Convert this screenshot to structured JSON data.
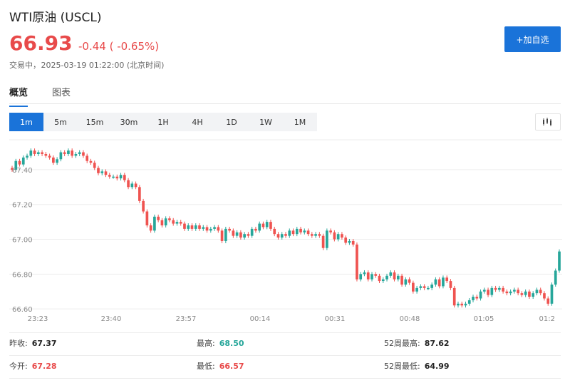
{
  "header": {
    "title": "WTI原油  (USCL)",
    "price": "66.93",
    "change": "-0.44 ( -0.65%)",
    "status": "交易中",
    "datetime": "2025-03-19 01:22:00",
    "timezone": "(北京时间)"
  },
  "actions": {
    "add_watchlist": "+加自选"
  },
  "tabs": [
    {
      "label": "概览",
      "active": true
    },
    {
      "label": "图表",
      "active": false
    }
  ],
  "intervals": [
    {
      "label": "1m",
      "active": true
    },
    {
      "label": "5m"
    },
    {
      "label": "15m"
    },
    {
      "label": "30m"
    },
    {
      "label": "1H"
    },
    {
      "label": "4H"
    },
    {
      "label": "1D"
    },
    {
      "label": "1W"
    },
    {
      "label": "1M"
    }
  ],
  "colors": {
    "up": "#26a69a",
    "down": "#ef5350",
    "accent": "#1a73d9",
    "grid": "#eeeeee"
  },
  "chart_data": {
    "type": "candlestick",
    "ytick_labels": [
      "67.40",
      "67.20",
      "67.00",
      "66.80",
      "66.60"
    ],
    "yticks": [
      67.4,
      67.2,
      67.0,
      66.8,
      66.6
    ],
    "xtick_labels": [
      "23:23",
      "23:40",
      "23:57",
      "00:14",
      "00:31",
      "00:48",
      "01:05",
      "01:2"
    ],
    "ylim": [
      66.58,
      67.58
    ],
    "grid": true,
    "candles": [
      [
        67.41,
        67.4
      ],
      [
        67.4,
        67.45
      ],
      [
        67.45,
        67.43
      ],
      [
        67.43,
        67.47
      ],
      [
        67.47,
        67.48
      ],
      [
        67.48,
        67.51
      ],
      [
        67.51,
        67.49
      ],
      [
        67.49,
        67.5
      ],
      [
        67.5,
        67.49
      ],
      [
        67.49,
        67.48
      ],
      [
        67.48,
        67.47
      ],
      [
        67.47,
        67.44
      ],
      [
        67.44,
        67.46
      ],
      [
        67.46,
        67.5
      ],
      [
        67.5,
        67.49
      ],
      [
        67.49,
        67.51
      ],
      [
        67.51,
        67.48
      ],
      [
        67.48,
        67.49
      ],
      [
        67.49,
        67.5
      ],
      [
        67.5,
        67.48
      ],
      [
        67.48,
        67.45
      ],
      [
        67.45,
        67.44
      ],
      [
        67.44,
        67.41
      ],
      [
        67.41,
        67.38
      ],
      [
        67.38,
        67.39
      ],
      [
        67.39,
        67.37
      ],
      [
        67.37,
        67.36
      ],
      [
        67.36,
        67.36
      ],
      [
        67.36,
        67.35
      ],
      [
        67.35,
        67.37
      ],
      [
        67.37,
        67.34
      ],
      [
        67.34,
        67.3
      ],
      [
        67.3,
        67.32
      ],
      [
        67.32,
        67.3
      ],
      [
        67.3,
        67.22
      ],
      [
        67.22,
        67.16
      ],
      [
        67.16,
        67.08
      ],
      [
        67.08,
        67.05
      ],
      [
        67.05,
        67.13
      ],
      [
        67.13,
        67.11
      ],
      [
        67.11,
        67.08
      ],
      [
        67.08,
        67.12
      ],
      [
        67.12,
        67.11
      ],
      [
        67.11,
        67.09
      ],
      [
        67.09,
        67.1
      ],
      [
        67.1,
        67.09
      ],
      [
        67.09,
        67.06
      ],
      [
        67.06,
        67.08
      ],
      [
        67.08,
        67.06
      ],
      [
        67.06,
        67.08
      ],
      [
        67.08,
        67.06
      ],
      [
        67.06,
        67.07
      ],
      [
        67.07,
        67.05
      ],
      [
        67.05,
        67.06
      ],
      [
        67.06,
        67.07
      ],
      [
        67.07,
        67.05
      ],
      [
        67.05,
        66.99
      ],
      [
        66.99,
        67.06
      ],
      [
        67.06,
        67.05
      ],
      [
        67.05,
        67.02
      ],
      [
        67.02,
        67.04
      ],
      [
        67.04,
        67.01
      ],
      [
        67.01,
        67.03
      ],
      [
        67.03,
        67.02
      ],
      [
        67.02,
        67.06
      ],
      [
        67.06,
        67.05
      ],
      [
        67.05,
        67.09
      ],
      [
        67.09,
        67.07
      ],
      [
        67.07,
        67.1
      ],
      [
        67.1,
        67.06
      ],
      [
        67.06,
        67.03
      ],
      [
        67.03,
        67.01
      ],
      [
        67.01,
        67.03
      ],
      [
        67.03,
        67.02
      ],
      [
        67.02,
        67.05
      ],
      [
        67.05,
        67.03
      ],
      [
        67.03,
        67.06
      ],
      [
        67.06,
        67.04
      ],
      [
        67.04,
        67.05
      ],
      [
        67.05,
        67.03
      ],
      [
        67.03,
        67.02
      ],
      [
        67.02,
        67.03
      ],
      [
        67.03,
        67.02
      ],
      [
        67.02,
        66.95
      ],
      [
        66.95,
        67.05
      ],
      [
        67.05,
        67.04
      ],
      [
        67.04,
        67.0
      ],
      [
        67.0,
        67.03
      ],
      [
        67.03,
        67.01
      ],
      [
        67.01,
        66.98
      ],
      [
        66.98,
        66.99
      ],
      [
        66.99,
        66.97
      ],
      [
        66.97,
        66.77
      ],
      [
        66.77,
        66.8
      ],
      [
        66.8,
        66.81
      ],
      [
        66.81,
        66.77
      ],
      [
        66.77,
        66.8
      ],
      [
        66.8,
        66.79
      ],
      [
        66.79,
        66.76
      ],
      [
        66.76,
        66.77
      ],
      [
        66.77,
        66.79
      ],
      [
        66.79,
        66.81
      ],
      [
        66.81,
        66.77
      ],
      [
        66.77,
        66.79
      ],
      [
        66.79,
        66.74
      ],
      [
        66.74,
        66.77
      ],
      [
        66.77,
        66.75
      ],
      [
        66.75,
        66.7
      ],
      [
        66.7,
        66.72
      ],
      [
        66.72,
        66.73
      ],
      [
        66.73,
        66.72
      ],
      [
        66.72,
        66.72
      ],
      [
        66.72,
        66.74
      ],
      [
        66.74,
        66.77
      ],
      [
        66.77,
        66.73
      ],
      [
        66.73,
        66.78
      ],
      [
        66.78,
        66.76
      ],
      [
        66.76,
        66.72
      ],
      [
        66.72,
        66.62
      ],
      [
        66.62,
        66.63
      ],
      [
        66.63,
        66.62
      ],
      [
        66.62,
        66.63
      ],
      [
        66.63,
        66.65
      ],
      [
        66.65,
        66.67
      ],
      [
        66.67,
        66.66
      ],
      [
        66.66,
        66.7
      ],
      [
        66.7,
        66.71
      ],
      [
        66.71,
        66.68
      ],
      [
        66.68,
        66.72
      ],
      [
        66.72,
        66.71
      ],
      [
        66.71,
        66.72
      ],
      [
        66.72,
        66.7
      ],
      [
        66.7,
        66.69
      ],
      [
        66.69,
        66.7
      ],
      [
        66.7,
        66.71
      ],
      [
        66.71,
        66.69
      ],
      [
        66.69,
        66.68
      ],
      [
        66.68,
        66.7
      ],
      [
        66.7,
        66.67
      ],
      [
        66.67,
        66.69
      ],
      [
        66.69,
        66.71
      ],
      [
        66.71,
        66.69
      ],
      [
        66.69,
        66.66
      ],
      [
        66.66,
        66.63
      ],
      [
        66.63,
        66.74
      ],
      [
        66.74,
        66.82
      ],
      [
        66.82,
        66.93
      ]
    ]
  },
  "stats": {
    "prev_close_label": "昨收:",
    "prev_close": "67.37",
    "open_label": "今开:",
    "open": "67.28",
    "high_label": "最高:",
    "high": "68.50",
    "low_label": "最低:",
    "low": "66.57",
    "wk52_high_label": "52周最高:",
    "wk52_high": "87.62",
    "wk52_low_label": "52周最低:",
    "wk52_low": "64.99"
  }
}
